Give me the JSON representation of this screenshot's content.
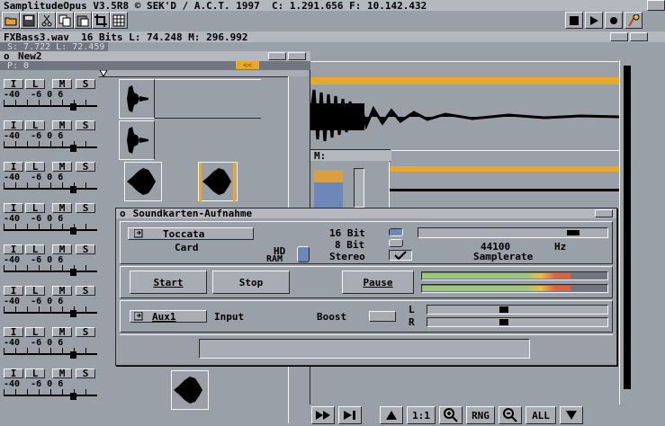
{
  "screen_title": "SamplitudeOpus V3.5R8 © SEK'D / A.C.T. 1997  C: 1.291.656 F: 10.142.432",
  "toolbar": {
    "icons": [
      "folder-open-icon",
      "disk-save-icon",
      "scissors-icon",
      "copy-icon",
      "paste-icon",
      "crop-icon",
      "grid-icon"
    ],
    "transport": [
      "stop-icon",
      "play-icon",
      "record-icon",
      "marker-icon"
    ]
  },
  "file_window": {
    "title": "FXBass3.wav  16 Bits L: 74.248 M: 296.992",
    "sub_label": "S: 7.722  L: 72.459"
  },
  "project_window": {
    "title": "New2",
    "pos_label": "P: 0",
    "track_buttons": [
      "I",
      "L",
      "M",
      "S"
    ],
    "scale_label": "-40  -6 0 6",
    "tracks": 8
  },
  "mid_window": {
    "label": "M:"
  },
  "dialog": {
    "title": "Soundkarten-Aufnahme",
    "card_button": "Toccata",
    "card_label": "Card",
    "hd_label": "HD",
    "ram_label": "RAM",
    "bit16_label": "16 Bit",
    "bit8_label": "8 Bit",
    "stereo_label": "Stereo",
    "rate_value": "44100",
    "rate_unit": "Hz",
    "rate_label": "Samplerate",
    "rate_fraction": 0.84,
    "start_label": "Start",
    "stop_label": "Stop",
    "pause_label": "Pause",
    "input_button": "Aux1",
    "input_label": "Input",
    "boost_label": "Boost",
    "left_label": "L",
    "right_label": "R",
    "level_l": 0.8,
    "level_r": 0.8,
    "gain_fraction": 0.42
  },
  "bottom_toolbar": {
    "labels": [
      "1:1",
      "RNG",
      "ALL"
    ],
    "icons": [
      "fast-forward-icon",
      "skip-end-icon",
      "up-arrow-icon",
      "zoom-in-icon",
      "zoom-out-icon",
      "down-arrow-icon"
    ]
  }
}
